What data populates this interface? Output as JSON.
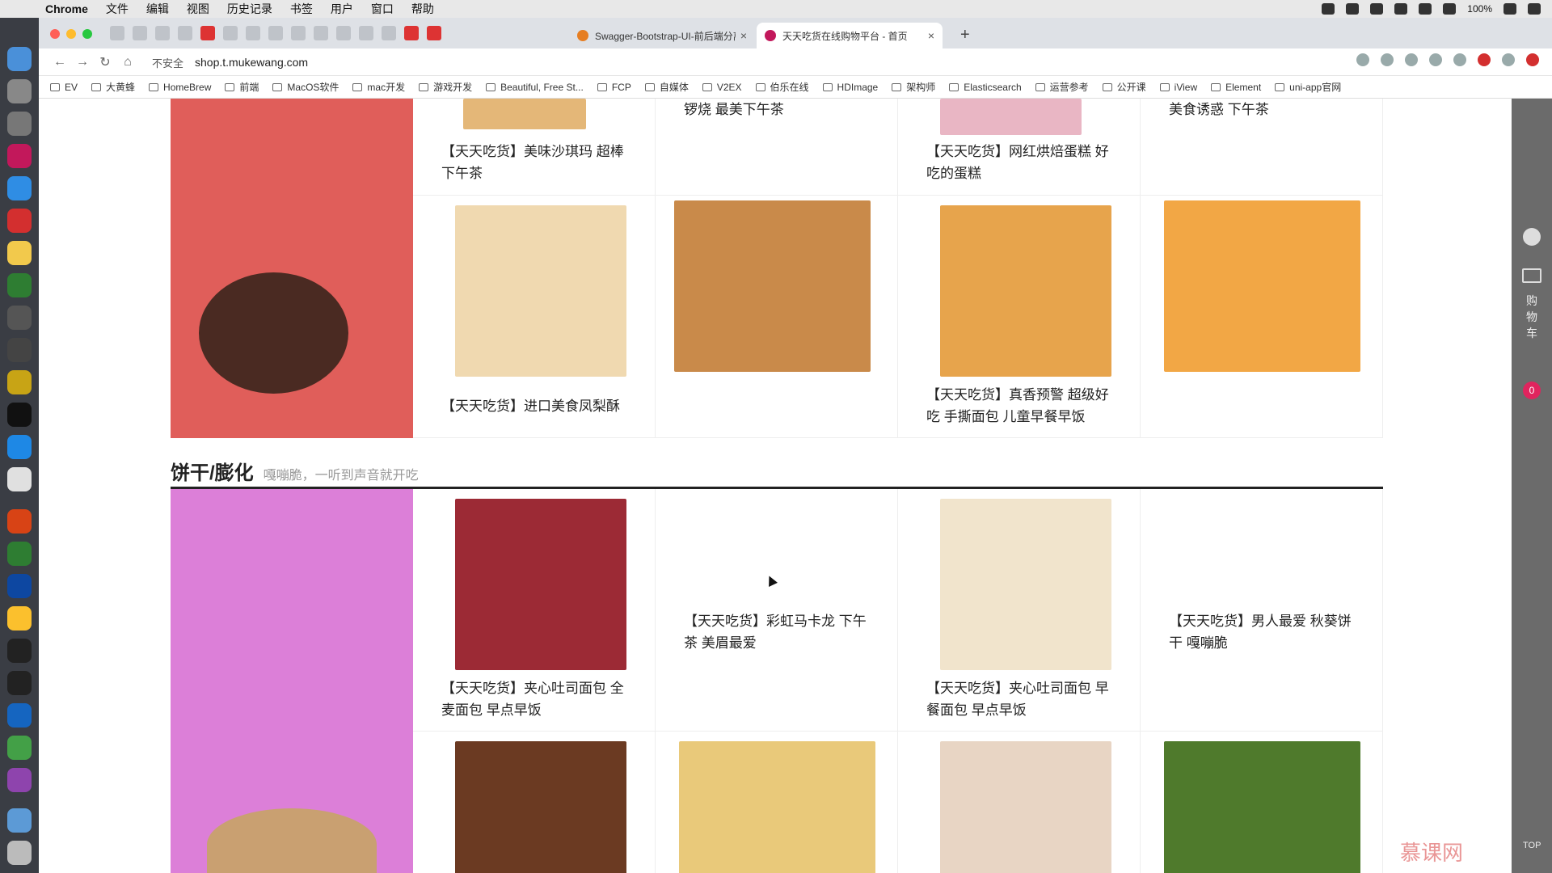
{
  "menubar": {
    "app": "Chrome",
    "items": [
      "文件",
      "编辑",
      "视图",
      "历史记录",
      "书签",
      "用户",
      "窗口",
      "帮助"
    ],
    "battery": "100%"
  },
  "tabs": [
    {
      "title": "Swagger-Bootstrap-UI-前后端分离",
      "close": "×"
    },
    {
      "title": "天天吃货在线购物平台 - 首页",
      "close": "×"
    }
  ],
  "new_tab": "+",
  "omnibox": {
    "security": "不安全",
    "url": "shop.t.mukewang.com"
  },
  "bookmarks": [
    "EV",
    "大黄蜂",
    "HomeBrew",
    "前端",
    "MacOS软件",
    "mac开发",
    "游戏开发",
    "Beautiful, Free St...",
    "FCP",
    "自媒体",
    "V2EX",
    "伯乐在线",
    "HDImage",
    "架构师",
    "Elasticsearch",
    "运营参考",
    "公开课",
    "iView",
    "Element",
    "uni-app官网"
  ],
  "cake_section": {
    "products": [
      {
        "title": "【天天吃货】美味沙琪玛 超棒下午茶"
      },
      {
        "title": "锣烧 最美下午茶"
      },
      {
        "title": "【天天吃货】网红烘焙蛋糕 好吃的蛋糕"
      },
      {
        "title": "美食诱惑 下午茶"
      },
      {
        "title": "【天天吃货】进口美食凤梨酥"
      },
      {
        "title": ""
      },
      {
        "title": "【天天吃货】真香预警 超级好吃 手撕面包 儿童早餐早饭"
      },
      {
        "title": ""
      }
    ]
  },
  "biscuit_section": {
    "heading": "饼干/膨化",
    "subtitle": "嘎嘣脆，一听到声音就开吃",
    "products": [
      {
        "title": "【天天吃货】夹心吐司面包 全麦面包 早点早饭"
      },
      {
        "title": "【天天吃货】彩虹马卡龙 下午茶 美眉最爱"
      },
      {
        "title": "【天天吃货】夹心吐司面包 早餐面包 早点早饭"
      },
      {
        "title": "【天天吃货】男人最爱 秋葵饼干 嘎嘣脆"
      }
    ]
  },
  "sidebar": {
    "cart_label": "购物车",
    "cart_count": "0",
    "top": "TOP"
  },
  "watermark": "慕课网"
}
